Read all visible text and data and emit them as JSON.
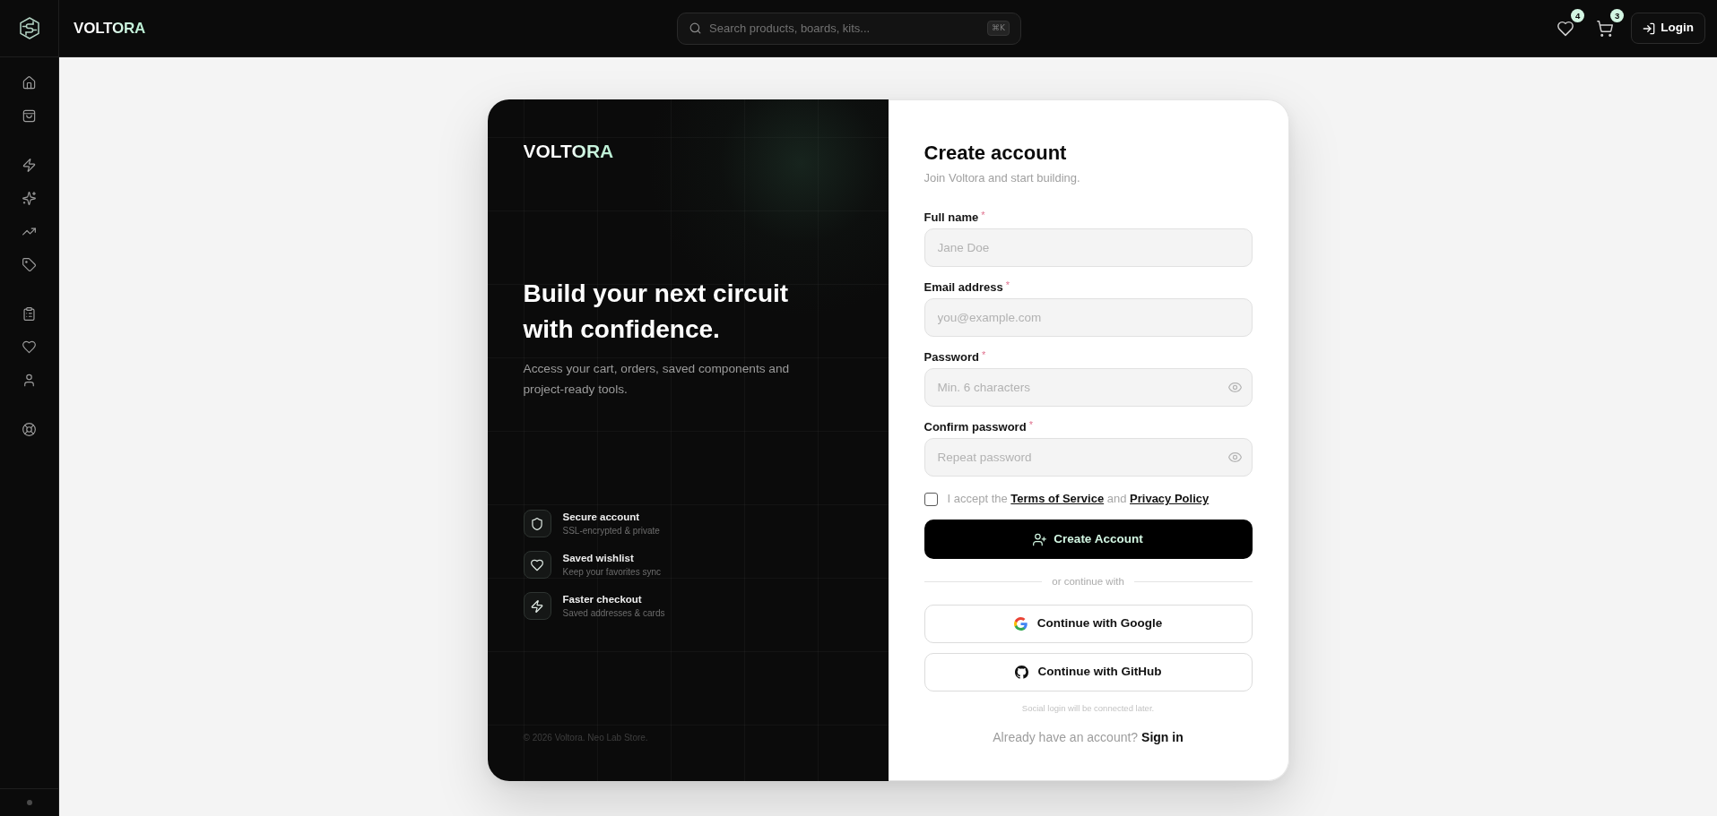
{
  "topbar": {
    "brand": "VOLTORA",
    "search": {
      "placeholder": "Search products, boards, kits...",
      "shortcut": "⌘K"
    },
    "wishlist_count": "4",
    "cart_count": "3",
    "login": "Login"
  },
  "promo": {
    "brand": "VOLTORA",
    "headline": "Build your next circuit with confidence.",
    "subtitle": "Access your cart, orders, saved components and project-ready tools.",
    "features": [
      {
        "title": "Secure account",
        "subtitle": "SSL-encrypted & private"
      },
      {
        "title": "Saved wishlist",
        "subtitle": "Keep your favorites sync"
      },
      {
        "title": "Faster checkout",
        "subtitle": "Saved addresses & cards"
      }
    ],
    "footer": "© 2026 Voltora. Neo Lab Store."
  },
  "form": {
    "title": "Create account",
    "subtitle": "Join Voltora and start building.",
    "fields": [
      {
        "kind": "text",
        "label": "Full name",
        "required_mark": "*",
        "placeholder": "Jane Doe"
      },
      {
        "kind": "email",
        "label": "Email address",
        "required_mark": "*",
        "placeholder": "you@example.com"
      },
      {
        "kind": "password",
        "label": "Password",
        "required_mark": "*",
        "placeholder": "Min. 6 characters"
      },
      {
        "kind": "password",
        "label": "Confirm password",
        "required_mark": "*",
        "placeholder": "Repeat password"
      }
    ],
    "terms": {
      "checked": false,
      "before": "I accept the",
      "terms_link": "Terms of Service",
      "joiner": "and",
      "privacy_link": "Privacy Policy"
    },
    "submit": "Create Account",
    "divider": "or continue with",
    "social": [
      {
        "label": "Continue with Google"
      },
      {
        "label": "Continue with GitHub"
      }
    ],
    "social_note": "Social login will be connected later.",
    "signin": {
      "prompt": "Already have an account?",
      "link": "Sign in"
    }
  }
}
